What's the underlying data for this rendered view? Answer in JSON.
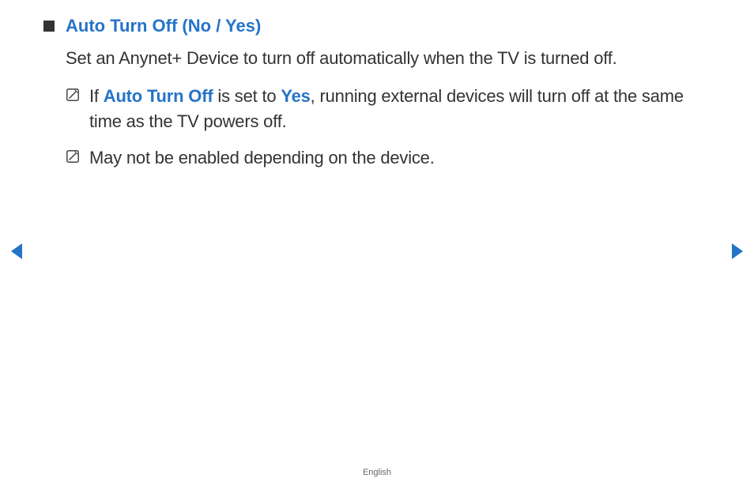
{
  "heading": "Auto Turn Off (No / Yes)",
  "body": "Set an Anynet+ Device to turn off automatically when the TV is turned off.",
  "note1": {
    "prefix": "If ",
    "boldTerm": "Auto Turn Off",
    "mid": " is set to ",
    "highlight": "Yes",
    "suffix": ", running external devices will turn off at the same time as the TV powers off."
  },
  "note2": "May not be enabled depending on the device.",
  "footer": "English"
}
